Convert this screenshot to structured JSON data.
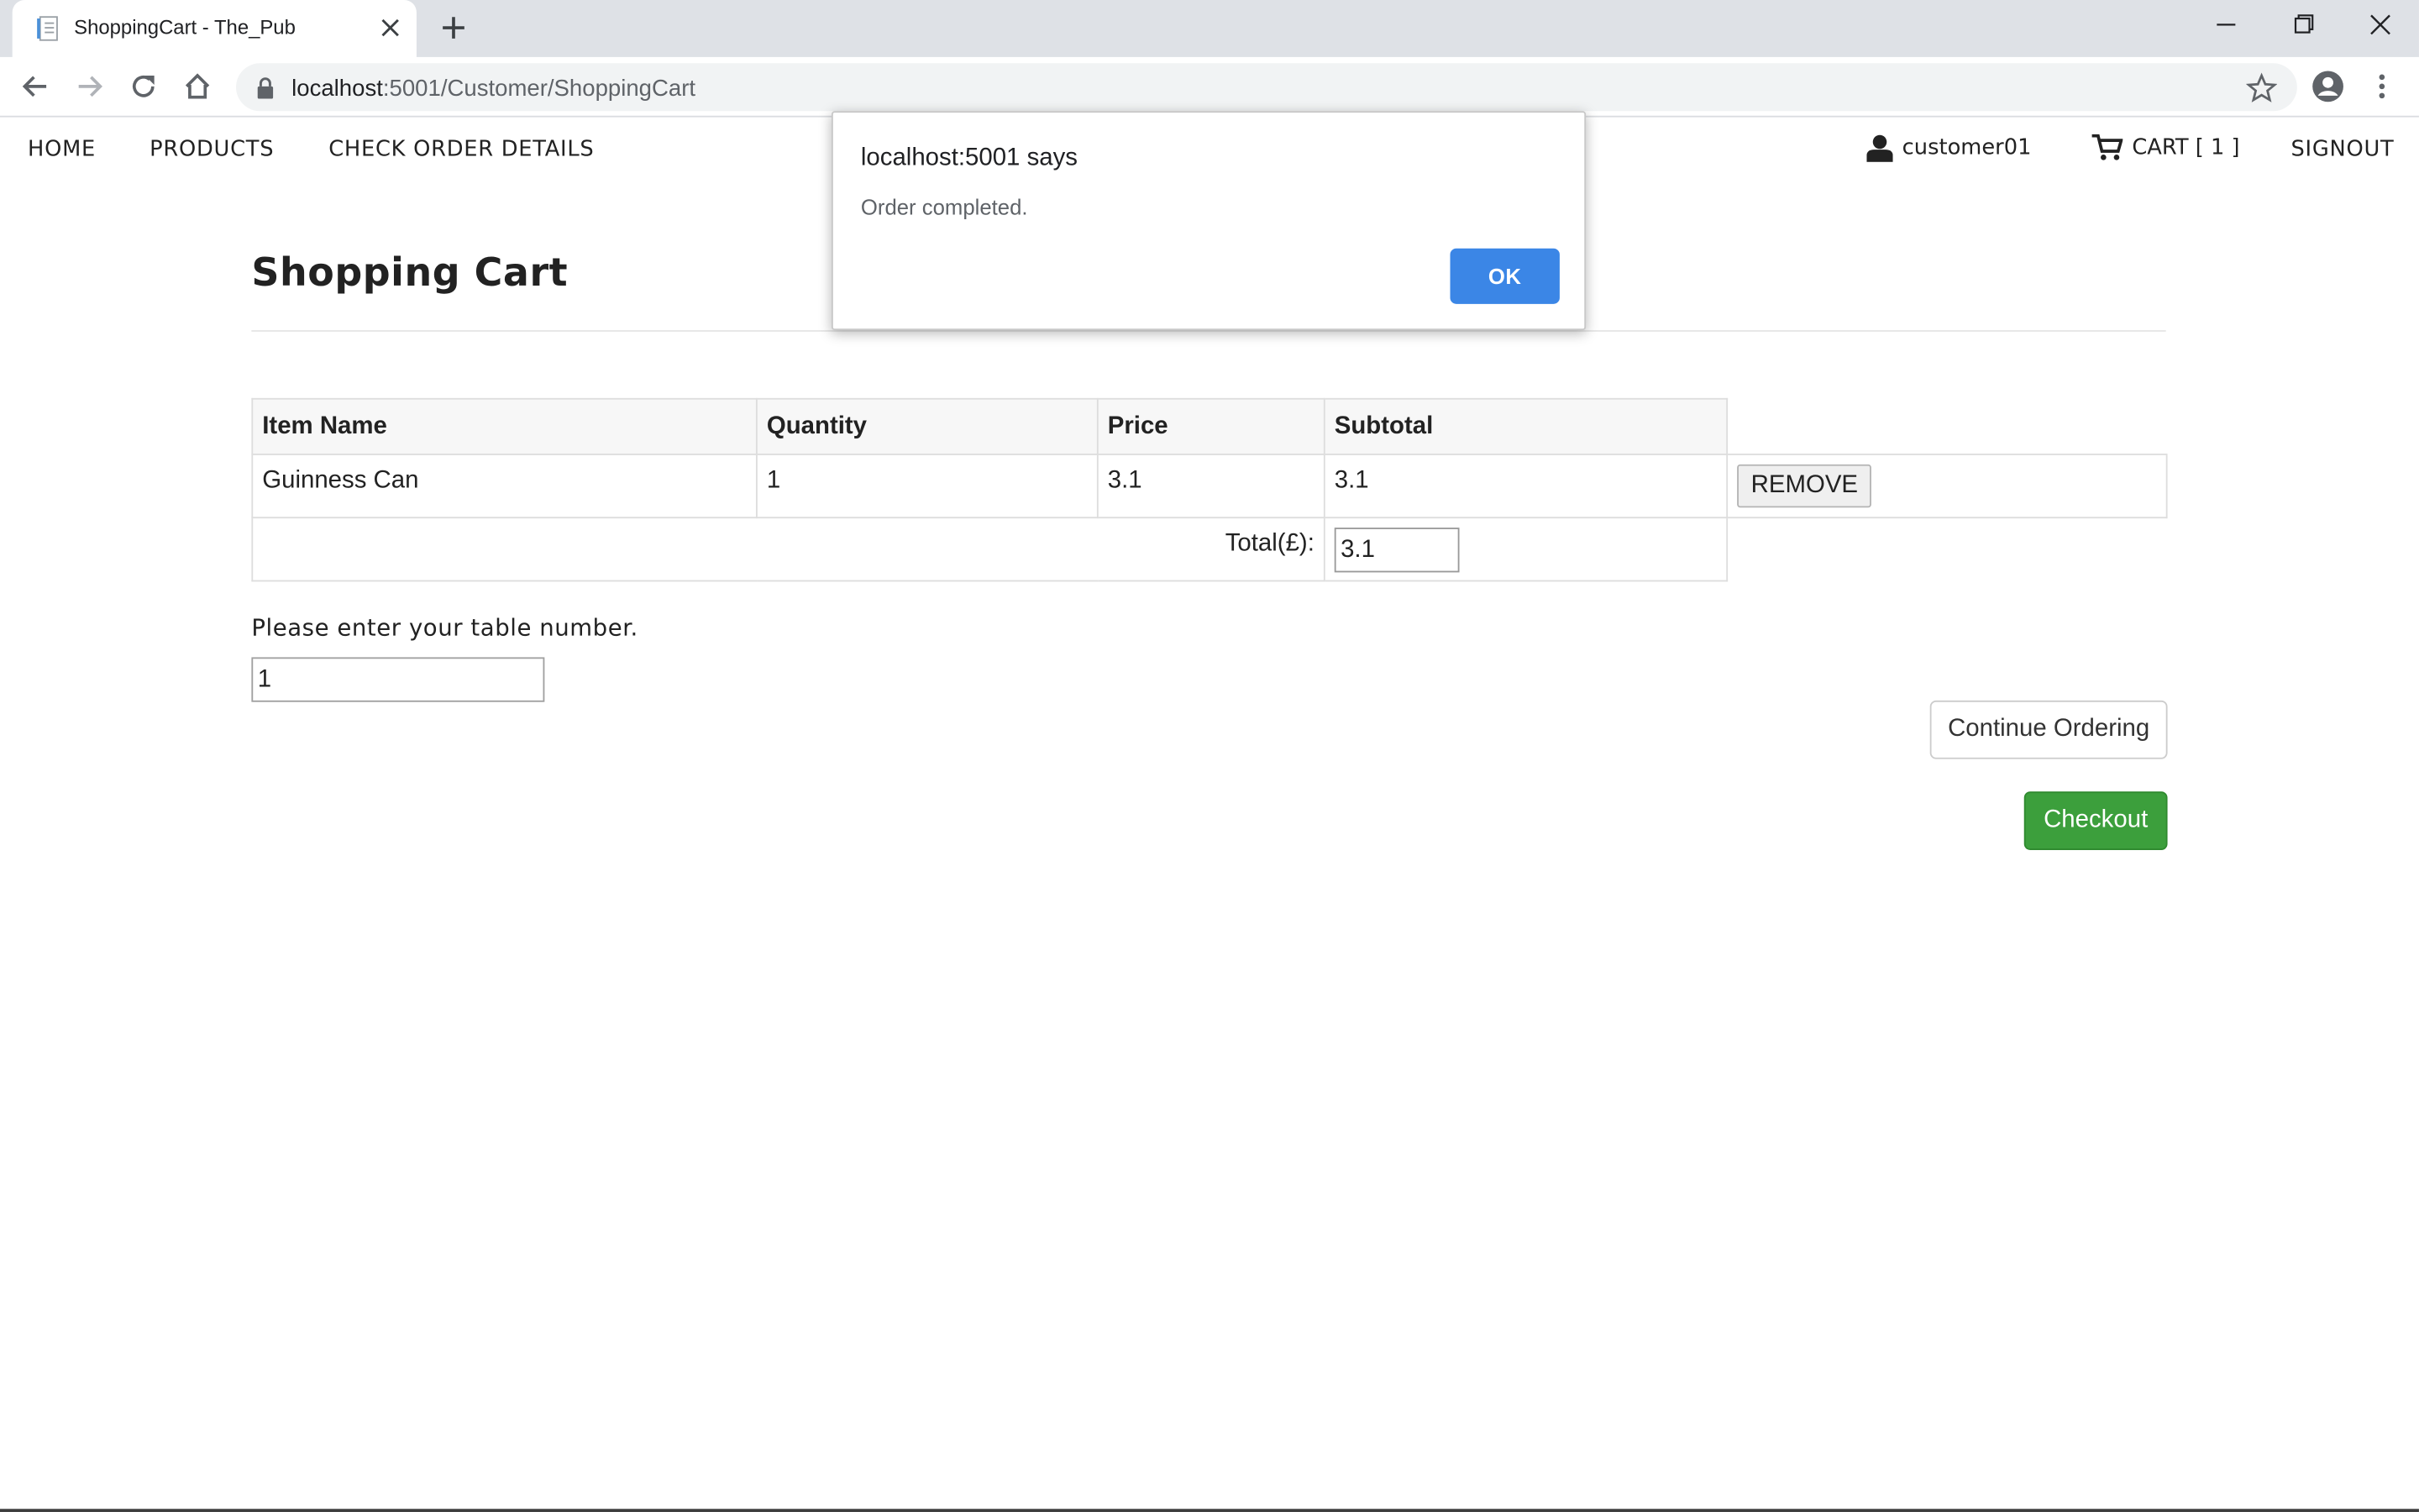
{
  "browser": {
    "tab_title": "ShoppingCart - The_Pub",
    "url_host": "localhost",
    "url_path": ":5001/Customer/ShoppingCart"
  },
  "nav": {
    "home": "HOME",
    "products": "PRODUCTS",
    "check_order_details": "CHECK ORDER DETAILS",
    "username": "customer01",
    "cart": "CART [ 1 ]",
    "signout": "SIGNOUT"
  },
  "page": {
    "title": "Shopping Cart"
  },
  "cart_table": {
    "headers": [
      "Item Name",
      "Quantity",
      "Price",
      "Subtotal"
    ],
    "rows": [
      {
        "item_name": "Guinness Can",
        "quantity": "1",
        "price": "3.1",
        "subtotal": "3.1",
        "action": "REMOVE"
      }
    ],
    "total_label": "Total(£):",
    "total_value": "3.1"
  },
  "table_number": {
    "prompt": "Please enter your table number.",
    "value": "1"
  },
  "buttons": {
    "continue": "Continue Ordering",
    "checkout": "Checkout"
  },
  "dialog": {
    "title": "localhost:5001 says",
    "message": "Order completed.",
    "ok": "OK"
  },
  "colors": {
    "checkout": "#3c9f3c",
    "dialog_ok": "#3b86e6",
    "tabstrip": "#dee1e6"
  },
  "icons": [
    "document-icon",
    "close-icon",
    "plus-icon",
    "minimize-icon",
    "restore-icon",
    "window-close-icon",
    "back-icon",
    "forward-icon",
    "reload-icon",
    "home-icon",
    "lock-icon",
    "star-icon",
    "profile-icon",
    "menu-icon",
    "user-icon",
    "cart-icon"
  ]
}
